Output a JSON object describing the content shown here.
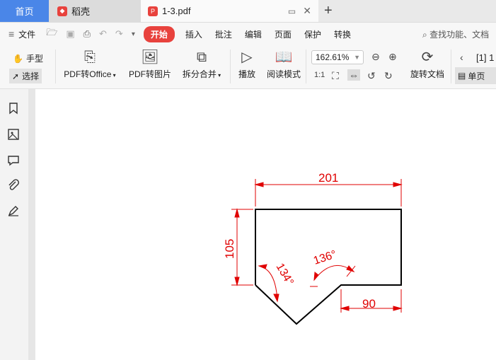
{
  "tabs": [
    {
      "label": "首页"
    },
    {
      "label": "稻壳"
    },
    {
      "label": "1-3.pdf"
    }
  ],
  "new_tab_symbol": "+",
  "menu": {
    "file_label": "文件",
    "items": [
      "开始",
      "插入",
      "批注",
      "编辑",
      "页面",
      "保护",
      "转换"
    ],
    "active_item": "开始",
    "search_placeholder": "查找功能、文档"
  },
  "ribbon": {
    "hand_label": "手型",
    "select_label": "选择",
    "pdf_to_office": "PDF转Office",
    "pdf_to_image": "PDF转图片",
    "split_merge": "拆分合并",
    "play": "播放",
    "read_mode": "阅读模式",
    "zoom_value": "162.61%",
    "rotate_doc": "旋转文档",
    "page_indicator": "[1] 1",
    "single_page": "单页"
  },
  "drawing": {
    "dimensions": [
      "201",
      "105",
      "134°",
      "136°",
      "90"
    ],
    "line_color": "#000000",
    "dim_color": "#e00000"
  }
}
